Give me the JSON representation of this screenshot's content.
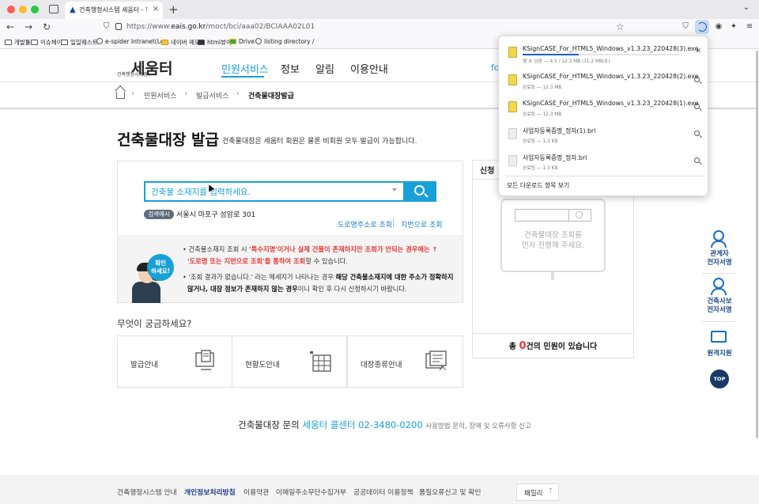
{
  "browser": {
    "tab_title": "건축행정시스템 세움터 - 민원서비스 ...",
    "url_prefix": "https://www.",
    "url_domain": "eais.go.kr",
    "url_rest": "/moct/bci/aaa02/BCIAAA02L01",
    "bookmarks": [
      "개발툴",
      "이슈체이",
      "일일퀘스트",
      "e-spider Intranet(Lo...",
      "네이버 메모",
      "html뷰어",
      "Drive",
      "listing directory /"
    ]
  },
  "site": {
    "logo_small": "건축행정시스템",
    "logo_main": "세움터",
    "nav": [
      "민원서비스",
      "정보",
      "알림",
      "이용안내"
    ],
    "header_cut": "fo"
  },
  "breadcrumb": [
    "민원서비스",
    "발급서비스",
    "건축물대장발급"
  ],
  "page": {
    "title": "건축물대장 발급",
    "desc": "건축물대장은 세움터 회원은 물론 비회원 모두 발급이 가능합니다."
  },
  "search": {
    "placeholder": "건축물 소재지를 입력하세요.",
    "example_badge": "검색예시",
    "example_text": "서울시 마포구 성암로 301",
    "link_road": "도로명주소로 조회",
    "link_jibun": "지번으로 조회"
  },
  "help": {
    "bubble_line1": "확인",
    "bubble_line2": "하세요!",
    "line1_a": "• 건축물소재지 조회 시 ",
    "line1_red": "'특수지명'이거나 실제 건물이 존재하지만 조회가 안되는 경우에는 ↑",
    "line2_red": "'도로명 또는 지번으로 조회'를 통하여 조회",
    "line2_b": "할 수 있습니다.",
    "line3_a": "• '조회 결과가 없습니다.' 라는 메세지가 나타나는 경우 ",
    "line3_bold": "해당 건축물소재지에 대한 주소가 정확하지",
    "line4_bold": "않거나, 대장 정보가 존재하지 않는 경우",
    "line4_b": "이니 확인 후 다시 신청하시기 바랍니다."
  },
  "faq": {
    "title": "무엇이 궁금하세요?",
    "items": [
      "발급안내",
      "현황도안내",
      "대장종류안내"
    ]
  },
  "request_panel": {
    "tab": "신청",
    "empty_line1": "건축물대장 조회를",
    "empty_line2": "먼저 진행해 주세요.",
    "count_prefix": "총 ",
    "count": "0",
    "count_suffix": "건의 민원이 있습니다"
  },
  "side_nav": {
    "item1": [
      "관계자",
      "전자서명"
    ],
    "item2": [
      "건축사보",
      "전자서명"
    ],
    "item3": "원격지원",
    "top": "TOP"
  },
  "contact": {
    "prefix": "건축물대장 문의",
    "center": "세움터 콜센터 02-3480-0200",
    "suffix": "사용방법 문의, 장애 및 오류사항 신고"
  },
  "footer": {
    "links": [
      "건축행정시스템 안내",
      "개인정보처리방침",
      "이용약관",
      "이메일주소무단수집거부",
      "공공데이터 이용정책",
      "품질오류신고 및 확인"
    ],
    "family": "패밀리",
    "family_icon": "↑"
  },
  "downloads": {
    "items": [
      {
        "name": "KSignCASE_For_HTML5_Windows_v1.3.23_220428(3).exe",
        "status": "몇 초 남음 — 4.5 / 12.3 MB (11.2 MB/초)",
        "progress": 0.36
      },
      {
        "name": "KSignCASE_For_HTML5_Windows_v1.3.23_220428(2).exe",
        "status": "완료됨 — 12.3 MB"
      },
      {
        "name": "KSignCASE_For_HTML5_Windows_v1.3.23_220428(1).exe",
        "status": "완료됨 — 12.3 MB"
      },
      {
        "name": "사업자등록증명_정자(1).brl",
        "status": "완료됨 — 1.3 KB"
      },
      {
        "name": "사업자등록증명_정자.brl",
        "status": "완료됨 — 1.3 KB"
      }
    ],
    "show_all": "모든 다운로드 항목 보기",
    "cancel_icon": "✕"
  },
  "colors": {
    "accent": "#1aa0d8",
    "alert": "#e53935",
    "navy": "#1a3a66"
  }
}
